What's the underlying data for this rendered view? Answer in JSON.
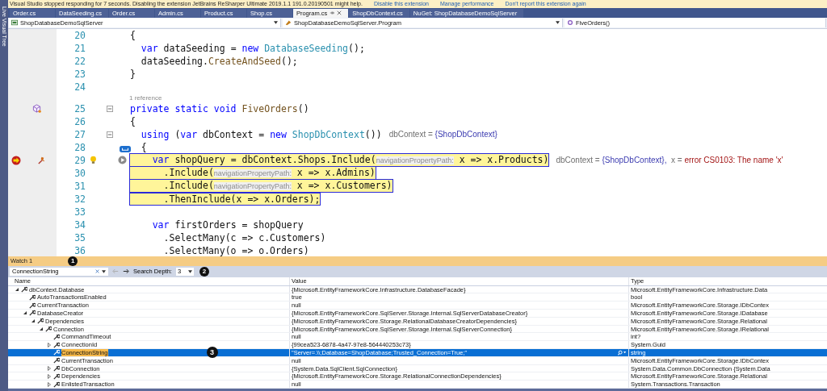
{
  "side_tab": "Live Visual Tree",
  "notification": {
    "message": "Visual Studio stopped responding for 7 seconds. Disabling the extension JetBrains ReSharper Ultimate 2019.1.1 191.0.20190501 might help.",
    "links": [
      "Disable this extension",
      "Manage performance",
      "Don't report this extension again"
    ]
  },
  "tabs": [
    {
      "label": "Order.cs",
      "selected": false
    },
    {
      "label": "DataSeeding.cs",
      "selected": false
    },
    {
      "label": "Order.cs",
      "selected": false
    },
    {
      "label": "Admin.cs",
      "selected": false
    },
    {
      "label": "Product.cs",
      "selected": false
    },
    {
      "label": "Shop.cs",
      "selected": false
    },
    {
      "label": "Program.cs",
      "selected": true
    },
    {
      "label": "ShopDbContext.cs",
      "selected": false
    },
    {
      "label": "NuGet: ShopDatabaseDemoSqlServer",
      "selected": false
    }
  ],
  "nav": {
    "project": "ShopDatabaseDemoSqlServer",
    "type": "ShopDatabaseDemoSqlServer.Program",
    "member": "FiveOrders()"
  },
  "code_lines": [
    {
      "number": "20",
      "tokens": [
        {
          "kind": "plain",
          "text": "{"
        }
      ]
    },
    {
      "number": "21",
      "tokens": [
        {
          "kind": "kw",
          "text": "  var"
        },
        {
          "kind": "plain",
          "text": " dataSeeding = "
        },
        {
          "kind": "kw",
          "text": "new"
        },
        {
          "kind": "type",
          "text": " DatabaseSeeding"
        },
        {
          "kind": "plain",
          "text": "();"
        }
      ]
    },
    {
      "number": "22",
      "tokens": [
        {
          "kind": "plain",
          "text": "  dataSeeding."
        },
        {
          "kind": "method",
          "text": "CreateAndSeed"
        },
        {
          "kind": "plain",
          "text": "();"
        }
      ]
    },
    {
      "number": "23",
      "tokens": [
        {
          "kind": "plain",
          "text": "}"
        }
      ]
    },
    {
      "number": "24"
    },
    {
      "number": "25",
      "codelens": "1 reference",
      "glyphs": [
        {
          "kind": "class"
        },
        {
          "kind": "fold"
        }
      ],
      "tokens": [
        {
          "kind": "kw",
          "text": "private static void"
        },
        {
          "kind": "method",
          "text": " FiveOrders"
        },
        {
          "kind": "plain",
          "text": "()"
        }
      ]
    },
    {
      "number": "26",
      "tokens": [
        {
          "kind": "plain",
          "text": "{"
        }
      ]
    },
    {
      "number": "27",
      "glyphs": [
        {
          "kind": "fold"
        }
      ],
      "tokens": [
        {
          "kind": "kw",
          "text": "  using"
        },
        {
          "kind": "plain",
          "text": " ("
        },
        {
          "kind": "kw",
          "text": "var"
        },
        {
          "kind": "plain",
          "text": " dbContext = "
        },
        {
          "kind": "kw",
          "text": "new"
        },
        {
          "kind": "type",
          "text": " ShopDbContext"
        },
        {
          "kind": "plain",
          "text": "())"
        }
      ],
      "datatips": [
        {
          "kind": "name",
          "text": "dbContext = "
        },
        {
          "kind": "value",
          "text": "{ShopDbContext}"
        }
      ]
    },
    {
      "number": "28",
      "glyphs": [
        {
          "kind": "marker"
        }
      ],
      "tokens": [
        {
          "kind": "plain",
          "text": "  {"
        }
      ]
    },
    {
      "number": "29",
      "highlighted": true,
      "glyphs": [
        {
          "kind": "breakpoint"
        },
        {
          "kind": "tool"
        },
        {
          "kind": "bulb"
        },
        {
          "kind": "run"
        }
      ],
      "tokens": [
        {
          "kind": "kw",
          "text": "    var"
        },
        {
          "kind": "plain",
          "text": " shopQuery = dbContext.Shops.Include("
        },
        {
          "kind": "hint",
          "text": "navigationPropertyPath:"
        },
        {
          "kind": "plain",
          "text": " x => x.Products)"
        }
      ],
      "datatips": [
        {
          "kind": "name",
          "text": "dbContext = "
        },
        {
          "kind": "value",
          "text": "{ShopDbContext},"
        },
        {
          "kind": "name",
          "text": "  x = "
        },
        {
          "kind": "error",
          "text": "error CS0103: The name 'x'"
        }
      ]
    },
    {
      "number": "30",
      "highlighted": true,
      "tokens": [
        {
          "kind": "plain",
          "text": "      .Include("
        },
        {
          "kind": "hint",
          "text": "navigationPropertyPath:"
        },
        {
          "kind": "plain",
          "text": " x => x.Admins)"
        }
      ]
    },
    {
      "number": "31",
      "highlighted": true,
      "tokens": [
        {
          "kind": "plain",
          "text": "      .Include("
        },
        {
          "kind": "hint",
          "text": "navigationPropertyPath:"
        },
        {
          "kind": "plain",
          "text": " x => x.Customers)"
        }
      ]
    },
    {
      "number": "32",
      "highlighted": true,
      "tokens": [
        {
          "kind": "plain",
          "text": "      .ThenInclude(x => x.Orders);"
        }
      ]
    },
    {
      "number": "33"
    },
    {
      "number": "34",
      "tokens": [
        {
          "kind": "kw",
          "text": "    var"
        },
        {
          "kind": "plain",
          "text": " firstOrders = shopQuery"
        }
      ]
    },
    {
      "number": "35",
      "tokens": [
        {
          "kind": "plain",
          "text": "      .SelectMany(c => c.Customers)"
        }
      ]
    },
    {
      "number": "36",
      "tokens": [
        {
          "kind": "plain",
          "text": "      .SelectMany(o => o.Orders)"
        }
      ]
    }
  ],
  "watch": {
    "title": "Watch 1",
    "title_callout": "1",
    "search": "ConnectionString",
    "search_depth_label": "Search Depth:",
    "search_depth": "3",
    "toolbar_callout": "2",
    "columns": [
      "Name",
      "Value",
      "Type"
    ],
    "rows": [
      {
        "name": "dbContext.Database",
        "value": "{Microsoft.EntityFrameworkCore.Infrastructure.DatabaseFacade}",
        "type": "Microsoft.EntityFrameworkCore.Infrastructure.Data",
        "kind": "node",
        "expanded": true,
        "selected": false,
        "children": [
          {
            "name": "AutoTransactionsEnabled",
            "value": "true",
            "type": "bool",
            "kind": "leaf",
            "selected": false
          },
          {
            "name": "CurrentTransaction",
            "value": "null",
            "type": "Microsoft.EntityFrameworkCore.Storage.IDbContex",
            "kind": "leaf",
            "selected": false
          },
          {
            "name": "DatabaseCreator",
            "value": "{Microsoft.EntityFrameworkCore.SqlServer.Storage.Internal.SqlServerDatabaseCreator}",
            "type": "Microsoft.EntityFrameworkCore.Storage.IDatabase",
            "kind": "node",
            "expanded": true,
            "selected": false,
            "children": [
              {
                "name": "Dependencies",
                "value": "{Microsoft.EntityFrameworkCore.Storage.RelationalDatabaseCreatorDependencies}",
                "type": "Microsoft.EntityFrameworkCore.Storage.Relational",
                "kind": "node",
                "expanded": true,
                "selected": false,
                "children": [
                  {
                    "name": "Connection",
                    "value": "{Microsoft.EntityFrameworkCore.SqlServer.Storage.Internal.SqlServerConnection}",
                    "type": "Microsoft.EntityFrameworkCore.Storage.IRelational",
                    "kind": "node",
                    "expanded": true,
                    "selected": false,
                    "children": [
                      {
                        "name": "CommandTimeout",
                        "value": "null",
                        "type": "int?",
                        "kind": "leaf",
                        "selected": false
                      },
                      {
                        "name": "ConnectionId",
                        "value": "{99cea523-6878-4a47-97e8-564440253c73}",
                        "type": "System.Guid",
                        "kind": "node",
                        "expanded": false,
                        "selected": false
                      },
                      {
                        "name": "ConnectionString",
                        "value": "\"Server=.\\\\;Database=ShopDatabase;Trusted_Connection=True;\"",
                        "type": "string",
                        "kind": "leaf",
                        "selected": true,
                        "match": true,
                        "visualizer": true,
                        "callout": "3"
                      },
                      {
                        "name": "CurrentTransaction",
                        "value": "null",
                        "type": "Microsoft.EntityFrameworkCore.Storage.IDbContex",
                        "kind": "leaf",
                        "selected": false
                      },
                      {
                        "name": "DbConnection",
                        "value": "{System.Data.SqlClient.SqlConnection}",
                        "type": "System.Data.Common.DbConnection {System.Data",
                        "kind": "node",
                        "expanded": false,
                        "selected": false
                      },
                      {
                        "name": "Dependencies",
                        "value": "{Microsoft.EntityFrameworkCore.Storage.RelationalConnectionDependencies}",
                        "type": "Microsoft.EntityFrameworkCore.Storage.Relational",
                        "kind": "node",
                        "expanded": false,
                        "selected": false
                      },
                      {
                        "name": "EnlistedTransaction",
                        "value": "null",
                        "type": "System.Transactions.Transaction",
                        "kind": "node",
                        "expanded": false,
                        "selected": false
                      }
                    ]
                  }
                ]
              }
            ]
          }
        ]
      }
    ]
  }
}
